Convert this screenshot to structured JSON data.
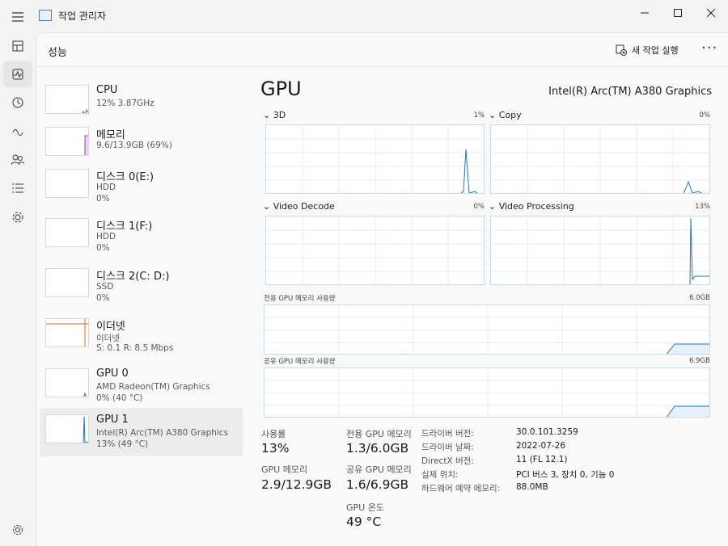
{
  "window": {
    "title": "작업 관리자"
  },
  "header": {
    "title": "성능",
    "new_task": "새 작업 실행"
  },
  "colors": {
    "gpu": "#1f77b4",
    "memory": "#8e44ad",
    "ethernet": "#e06a1a",
    "disk": "#4caf50"
  },
  "sidebar_items": [
    {
      "name": "CPU",
      "sub1": "12%  3.87GHz",
      "sub2": ""
    },
    {
      "name": "메모리",
      "sub1": "9.6/13.9GB (69%)",
      "sub2": ""
    },
    {
      "name": "디스크 0(E:)",
      "sub1": "HDD",
      "sub2": "0%"
    },
    {
      "name": "디스크 1(F:)",
      "sub1": "HDD",
      "sub2": "0%"
    },
    {
      "name": "디스크 2(C: D:)",
      "sub1": "SSD",
      "sub2": "0%"
    },
    {
      "name": "이더넷",
      "sub1": "이더넷",
      "sub2": "S: 0.1  R: 8.5 Mbps"
    },
    {
      "name": "GPU 0",
      "sub1": "AMD Radeon(TM) Graphics",
      "sub2": "0% (40 °C)"
    },
    {
      "name": "GPU 1",
      "sub1": "Intel(R) Arc(TM) A380 Graphics",
      "sub2": "13% (49 °C)"
    }
  ],
  "gpu": {
    "title": "GPU",
    "model": "Intel(R) Arc(TM) A380 Graphics",
    "engines": [
      {
        "label": "3D",
        "percent": "1%"
      },
      {
        "label": "Copy",
        "percent": "0%"
      },
      {
        "label": "Video Decode",
        "percent": "0%"
      },
      {
        "label": "Video Processing",
        "percent": "13%"
      }
    ],
    "dedicated_mem": {
      "label": "전용 GPU 메모리 사용량",
      "max": "6.0GB"
    },
    "shared_mem": {
      "label": "공유 GPU 메모리 사용량",
      "max": "6.9GB"
    },
    "stats": {
      "util_label": "사용률",
      "util_value": "13%",
      "gpumem_label": "GPU 메모리",
      "gpumem_value": "2.9/12.9GB",
      "dedicated_label": "전용 GPU 메모리",
      "dedicated_value": "1.3/6.0GB",
      "shared_label": "공유 GPU 메모리",
      "shared_value": "1.6/6.9GB",
      "temp_label": "GPU 온도",
      "temp_value": "49 °C"
    },
    "details": [
      {
        "key": "드라이버 버전:",
        "value": "30.0.101.3259"
      },
      {
        "key": "드라이버 날짜:",
        "value": "2022-07-26"
      },
      {
        "key": "DirectX 버전:",
        "value": "11 (FL 12.1)"
      },
      {
        "key": "실제 위치:",
        "value": "PCI 버스 3, 장치 0, 기능 0"
      },
      {
        "key": "하드웨어 예약 메모리:",
        "value": "88.0MB"
      }
    ]
  }
}
